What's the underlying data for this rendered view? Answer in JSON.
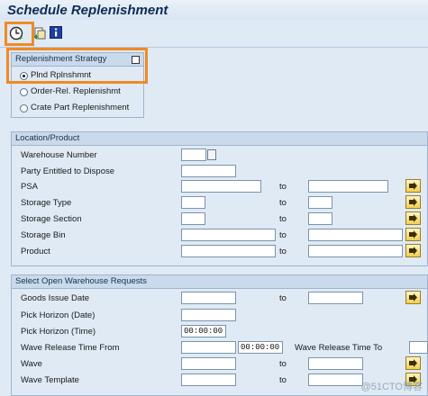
{
  "window": {
    "title": "Schedule Replenishment"
  },
  "toolbar": {
    "execute_icon": "clock-execute-icon",
    "variant_icon": "get-variant-icon",
    "info_icon": "info-icon"
  },
  "strategy": {
    "title": "Replenishment Strategy",
    "options": [
      "Plnd Rplnshmnt",
      "Order-Rel. Replenishmt",
      "Crate Part Replenishment"
    ],
    "selected": "Plnd Rplnshmnt"
  },
  "location": {
    "title": "Location/Product",
    "fields": {
      "warehouse_number": {
        "label": "Warehouse Number",
        "value": ""
      },
      "party": {
        "label": "Party Entitled to Dispose",
        "value": ""
      },
      "psa": {
        "label": "PSA",
        "to": "to"
      },
      "storage_type": {
        "label": "Storage Type",
        "to": "to"
      },
      "storage_section": {
        "label": "Storage Section",
        "to": "to"
      },
      "storage_bin": {
        "label": "Storage Bin",
        "to": "to"
      },
      "product": {
        "label": "Product",
        "to": "to"
      }
    }
  },
  "requests": {
    "title": "Select Open Warehouse Requests",
    "goods_issue_date": {
      "label": "Goods Issue Date",
      "to": "to"
    },
    "pick_horizon_date": {
      "label": "Pick Horizon (Date)"
    },
    "pick_horizon_time": {
      "label": "Pick Horizon (Time)",
      "value": "00:00:00"
    },
    "wave_release_from": {
      "label": "Wave Release Time From",
      "time": "00:00:00",
      "to_label": "Wave Release Time To"
    },
    "wave": {
      "label": "Wave",
      "to": "to"
    },
    "wave_template": {
      "label": "Wave Template",
      "to": "to"
    }
  },
  "watermark": "@51CTO博客",
  "colors": {
    "highlight": "#f08a24",
    "background": "#dfeaf5",
    "title_text": "#0e2c53"
  }
}
